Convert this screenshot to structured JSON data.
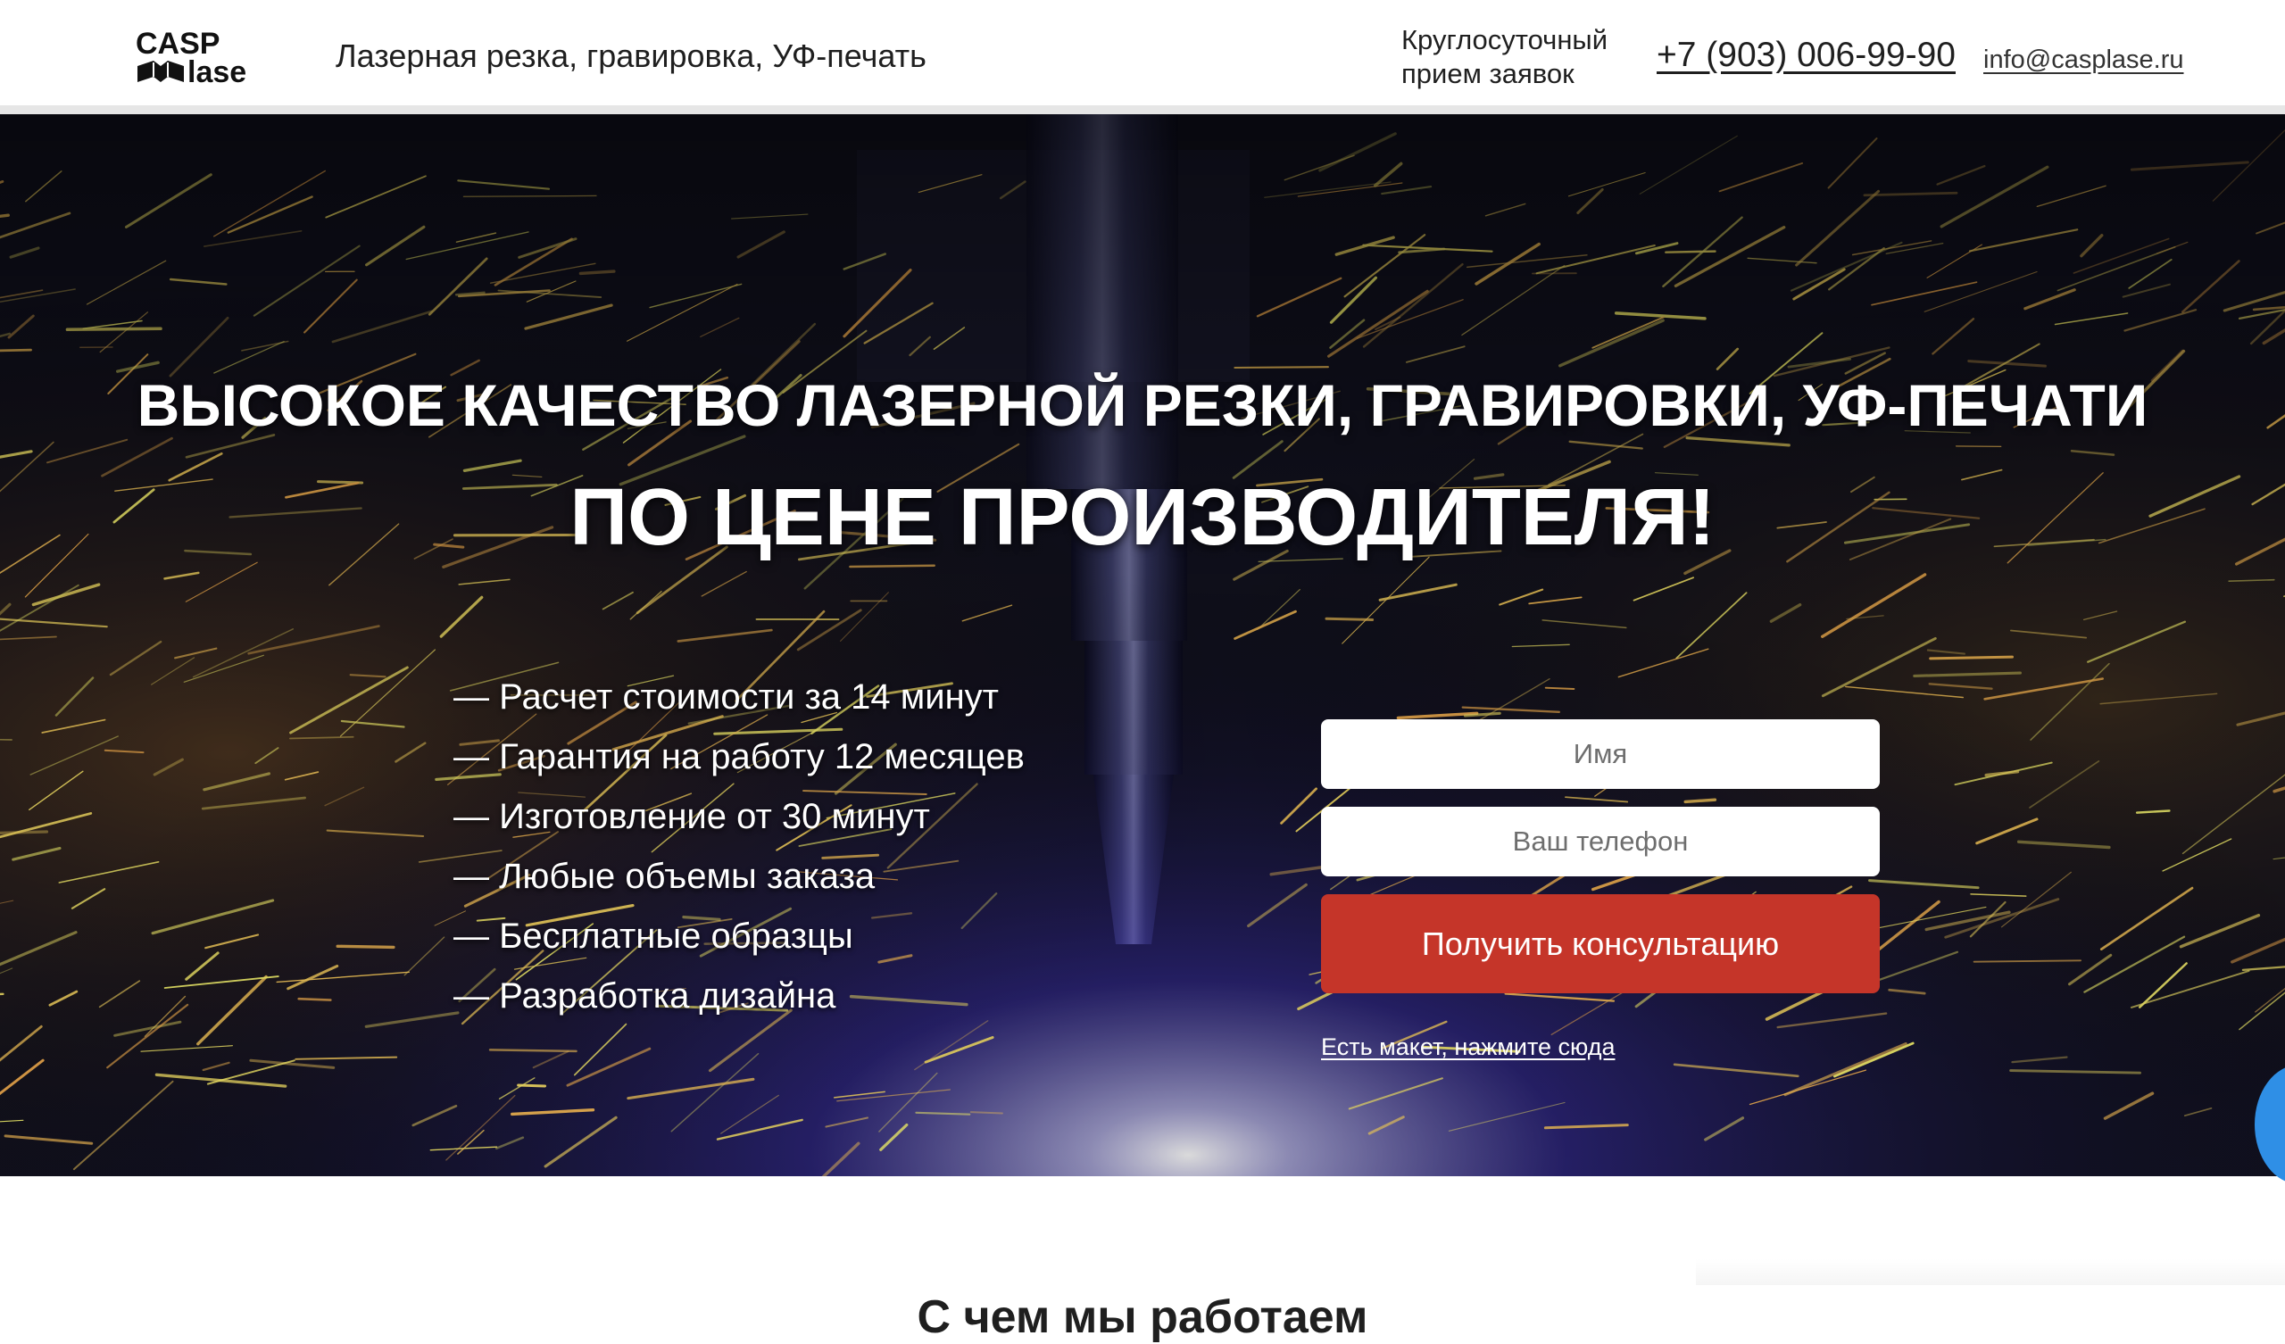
{
  "header": {
    "logo_text_top": "CASP",
    "logo_text_bottom": "lase",
    "tagline": "Лазерная резка, гравировка, УФ-печать",
    "hours_line1": "Круглосуточный",
    "hours_line2": "прием заявок",
    "phone": "+7 (903) 006-99-90",
    "email": "info@casplase.ru"
  },
  "hero": {
    "title_line1": "ВЫСОКОЕ КАЧЕСТВО ЛАЗЕРНОЙ РЕЗКИ, ГРАВИРОВКИ, УФ-ПЕЧАТИ",
    "title_line2": "ПО ЦЕНЕ ПРОИЗВОДИТЕЛЯ!",
    "benefits": [
      "— Расчет стоимости за 14 минут",
      "— Гарантия на работу 12 месяцев",
      "— Изготовление от 30 минут",
      "— Любые объемы заказа",
      "— Бесплатные образцы",
      "— Разработка дизайна"
    ]
  },
  "form": {
    "name_placeholder": "Имя",
    "phone_placeholder": "Ваш телефон",
    "submit_label": "Получить консультацию",
    "mockup_link": "Есть макет, нажмите сюда"
  },
  "next_section": {
    "title": "С чем мы работаем"
  },
  "colors": {
    "accent_red": "#c53529",
    "chat_blue": "#2f8fe6",
    "text_dark": "#1f1f1f"
  },
  "icons": {
    "chat_widget": "chat-bubble-icon"
  }
}
